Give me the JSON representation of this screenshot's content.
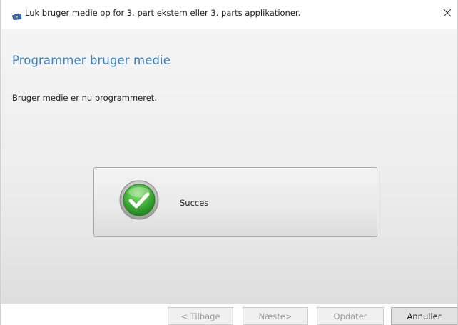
{
  "window": {
    "title": "Luk bruger medie op for 3. part ekstern eller 3. parts applikationer.",
    "icon": "smartcard-icon"
  },
  "page": {
    "heading": "Programmer bruger medie",
    "message": "Bruger medie er nu programmeret."
  },
  "status": {
    "icon": "success-check-icon",
    "text": "Succes"
  },
  "buttons": {
    "back": "< Tilbage",
    "next": "Næste>",
    "update": "Opdater",
    "cancel": "Annuller"
  },
  "colors": {
    "heading": "#3c82c0",
    "success_green": "#3fae3a",
    "disabled_text": "#9a9a9a"
  }
}
